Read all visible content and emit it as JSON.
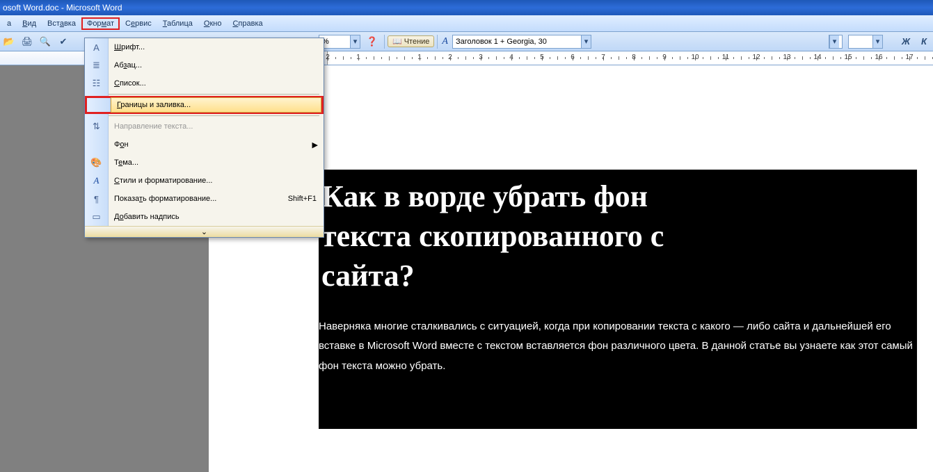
{
  "window": {
    "title": "osoft Word.doc - Microsoft Word"
  },
  "menubar": {
    "items": [
      {
        "label": "а"
      },
      {
        "label": "Вид"
      },
      {
        "label": "Вставка"
      },
      {
        "label": "Формат"
      },
      {
        "label": "Сервис"
      },
      {
        "label": "Таблица"
      },
      {
        "label": "Окно"
      },
      {
        "label": "Справка"
      }
    ],
    "open_index": 3
  },
  "toolbar": {
    "zoom_dd": "%",
    "reading_label": "Чтение",
    "style_box": "Заголовок 1 + Georgia, 30",
    "bold": "Ж",
    "italic": "К"
  },
  "ruler": {
    "numbers": [
      "2",
      "1",
      "",
      "1",
      "2",
      "3",
      "4",
      "5",
      "6",
      "7",
      "8",
      "9",
      "10",
      "11",
      "12",
      "13",
      "14",
      "15",
      "16",
      "17"
    ]
  },
  "dropdown": {
    "items": [
      {
        "icon": "font",
        "label": "Шрифт..."
      },
      {
        "icon": "para",
        "label": "Абзац..."
      },
      {
        "icon": "list",
        "label": "Список..."
      },
      {
        "icon": "",
        "label": "Границы и заливка...",
        "highlight": true
      },
      {
        "icon": "dir",
        "label": "Направление текста...",
        "disabled": true
      },
      {
        "icon": "",
        "label": "Фон",
        "submenu": true
      },
      {
        "icon": "theme",
        "label": "Тема..."
      },
      {
        "icon": "A",
        "label": "Стили и форматирование..."
      },
      {
        "icon": "reveal",
        "label": "Показать форматирование...",
        "shortcut": "Shift+F1"
      },
      {
        "icon": "textbox",
        "label": "Добавить надпись"
      }
    ]
  },
  "document": {
    "title_line1": "Как в ворде убрать фон",
    "title_line2": "текста скопированного с",
    "title_line3": "сайта?",
    "body": "Наверняка многие сталкивались с ситуацией, когда при копировании текста с какого — либо сайта и дальнейшей его вставке в Microsoft Word вместе с текстом вставляется фон различного цвета. В данной статье вы узнаете как этот самый фон текста можно убрать."
  }
}
